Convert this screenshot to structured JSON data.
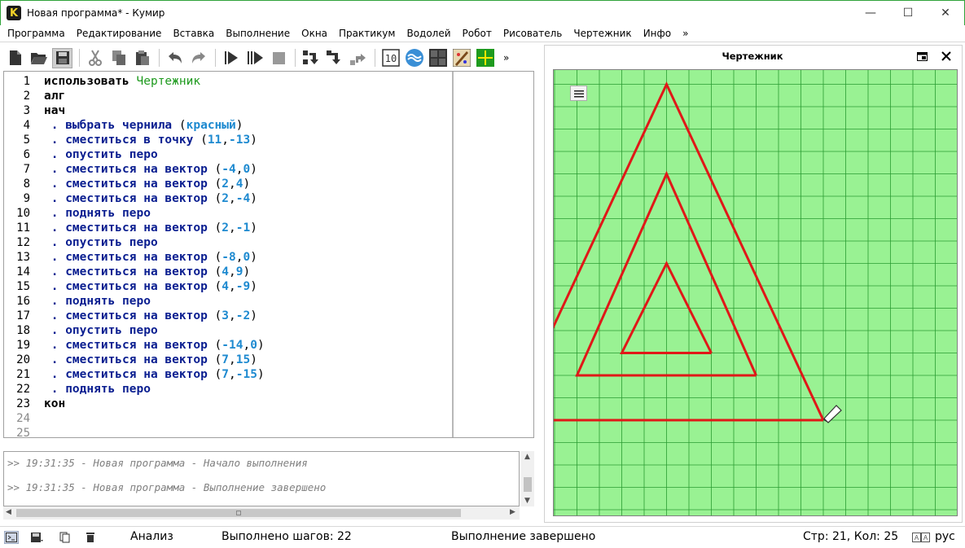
{
  "window": {
    "title": "Новая программа* - Кумир",
    "app_icon_letter": "K",
    "minimize": "—",
    "maximize": "☐",
    "close": "✕"
  },
  "menu": [
    "Программа",
    "Редактирование",
    "Вставка",
    "Выполнение",
    "Окна",
    "Практикум",
    "Водолей",
    "Робот",
    "Рисователь",
    "Чертежник",
    "Инфо",
    "»"
  ],
  "toolbar": {
    "icons": [
      "new-file-icon",
      "open-folder-icon",
      "save-icon",
      "cut-icon",
      "copy-icon",
      "paste-icon",
      "undo-icon",
      "redo-icon",
      "run-icon",
      "run-step-icon",
      "stop-icon",
      "step-over-icon",
      "step-into-icon",
      "step-out-icon",
      "number-icon",
      "vodoley-icon",
      "robot-icon",
      "risovatel-icon",
      "chertezhnik-icon"
    ],
    "more": "»",
    "number_icon_text": "10"
  },
  "editor": {
    "lines": [
      {
        "n": "1",
        "tokens": [
          {
            "t": "использовать ",
            "c": "kw"
          },
          {
            "t": "Чертежник",
            "c": "lib"
          }
        ]
      },
      {
        "n": "2",
        "tokens": [
          {
            "t": "алг",
            "c": "kw"
          }
        ]
      },
      {
        "n": "3",
        "tokens": [
          {
            "t": "нач",
            "c": "kw"
          }
        ]
      },
      {
        "n": "4",
        "tokens": [
          {
            "t": " . ",
            "c": "dot"
          },
          {
            "t": "выбрать чернила ",
            "c": "act"
          },
          {
            "t": "(",
            "c": "plain"
          },
          {
            "t": "красный",
            "c": "str"
          },
          {
            "t": ")",
            "c": "plain"
          }
        ]
      },
      {
        "n": "5",
        "tokens": [
          {
            "t": " . ",
            "c": "dot"
          },
          {
            "t": "сместиться в точку ",
            "c": "act"
          },
          {
            "t": "(",
            "c": "plain"
          },
          {
            "t": "11",
            "c": "num"
          },
          {
            "t": ",",
            "c": "plain"
          },
          {
            "t": "-13",
            "c": "num"
          },
          {
            "t": ")",
            "c": "plain"
          }
        ]
      },
      {
        "n": "6",
        "tokens": [
          {
            "t": " . ",
            "c": "dot"
          },
          {
            "t": "опустить перо",
            "c": "act"
          }
        ]
      },
      {
        "n": "7",
        "tokens": [
          {
            "t": " . ",
            "c": "dot"
          },
          {
            "t": "сместиться на вектор ",
            "c": "act"
          },
          {
            "t": "(",
            "c": "plain"
          },
          {
            "t": "-4",
            "c": "num"
          },
          {
            "t": ",",
            "c": "plain"
          },
          {
            "t": "0",
            "c": "num"
          },
          {
            "t": ")",
            "c": "plain"
          }
        ]
      },
      {
        "n": "8",
        "tokens": [
          {
            "t": " . ",
            "c": "dot"
          },
          {
            "t": "сместиться на вектор ",
            "c": "act"
          },
          {
            "t": "(",
            "c": "plain"
          },
          {
            "t": "2",
            "c": "num"
          },
          {
            "t": ",",
            "c": "plain"
          },
          {
            "t": "4",
            "c": "num"
          },
          {
            "t": ")",
            "c": "plain"
          }
        ]
      },
      {
        "n": "9",
        "tokens": [
          {
            "t": " . ",
            "c": "dot"
          },
          {
            "t": "сместиться на вектор ",
            "c": "act"
          },
          {
            "t": "(",
            "c": "plain"
          },
          {
            "t": "2",
            "c": "num"
          },
          {
            "t": ",",
            "c": "plain"
          },
          {
            "t": "-4",
            "c": "num"
          },
          {
            "t": ")",
            "c": "plain"
          }
        ]
      },
      {
        "n": "10",
        "tokens": [
          {
            "t": " . ",
            "c": "dot"
          },
          {
            "t": "поднять перо",
            "c": "act"
          }
        ]
      },
      {
        "n": "11",
        "tokens": [
          {
            "t": " . ",
            "c": "dot"
          },
          {
            "t": "сместиться на вектор ",
            "c": "act"
          },
          {
            "t": "(",
            "c": "plain"
          },
          {
            "t": "2",
            "c": "num"
          },
          {
            "t": ",",
            "c": "plain"
          },
          {
            "t": "-1",
            "c": "num"
          },
          {
            "t": ")",
            "c": "plain"
          }
        ]
      },
      {
        "n": "12",
        "tokens": [
          {
            "t": " . ",
            "c": "dot"
          },
          {
            "t": "опустить перо",
            "c": "act"
          }
        ]
      },
      {
        "n": "13",
        "tokens": [
          {
            "t": " . ",
            "c": "dot"
          },
          {
            "t": "сместиться на вектор ",
            "c": "act"
          },
          {
            "t": "(",
            "c": "plain"
          },
          {
            "t": "-8",
            "c": "num"
          },
          {
            "t": ",",
            "c": "plain"
          },
          {
            "t": "0",
            "c": "num"
          },
          {
            "t": ")",
            "c": "plain"
          }
        ]
      },
      {
        "n": "14",
        "tokens": [
          {
            "t": " . ",
            "c": "dot"
          },
          {
            "t": "сместиться на вектор ",
            "c": "act"
          },
          {
            "t": "(",
            "c": "plain"
          },
          {
            "t": "4",
            "c": "num"
          },
          {
            "t": ",",
            "c": "plain"
          },
          {
            "t": "9",
            "c": "num"
          },
          {
            "t": ")",
            "c": "plain"
          }
        ]
      },
      {
        "n": "15",
        "tokens": [
          {
            "t": " . ",
            "c": "dot"
          },
          {
            "t": "сместиться на вектор ",
            "c": "act"
          },
          {
            "t": "(",
            "c": "plain"
          },
          {
            "t": "4",
            "c": "num"
          },
          {
            "t": ",",
            "c": "plain"
          },
          {
            "t": "-9",
            "c": "num"
          },
          {
            "t": ")",
            "c": "plain"
          }
        ]
      },
      {
        "n": "16",
        "tokens": [
          {
            "t": " . ",
            "c": "dot"
          },
          {
            "t": "поднять перо",
            "c": "act"
          }
        ]
      },
      {
        "n": "17",
        "tokens": [
          {
            "t": " . ",
            "c": "dot"
          },
          {
            "t": "сместиться на вектор ",
            "c": "act"
          },
          {
            "t": "(",
            "c": "plain"
          },
          {
            "t": "3",
            "c": "num"
          },
          {
            "t": ",",
            "c": "plain"
          },
          {
            "t": "-2",
            "c": "num"
          },
          {
            "t": ")",
            "c": "plain"
          }
        ]
      },
      {
        "n": "18",
        "tokens": [
          {
            "t": " . ",
            "c": "dot"
          },
          {
            "t": "опустить перо",
            "c": "act"
          }
        ]
      },
      {
        "n": "19",
        "tokens": [
          {
            "t": " . ",
            "c": "dot"
          },
          {
            "t": "сместиться на вектор ",
            "c": "act"
          },
          {
            "t": "(",
            "c": "plain"
          },
          {
            "t": "-14",
            "c": "num"
          },
          {
            "t": ",",
            "c": "plain"
          },
          {
            "t": "0",
            "c": "num"
          },
          {
            "t": ")",
            "c": "plain"
          }
        ]
      },
      {
        "n": "20",
        "tokens": [
          {
            "t": " . ",
            "c": "dot"
          },
          {
            "t": "сместиться на вектор ",
            "c": "act"
          },
          {
            "t": "(",
            "c": "plain"
          },
          {
            "t": "7",
            "c": "num"
          },
          {
            "t": ",",
            "c": "plain"
          },
          {
            "t": "15",
            "c": "num"
          },
          {
            "t": ")",
            "c": "plain"
          }
        ]
      },
      {
        "n": "21",
        "tokens": [
          {
            "t": " . ",
            "c": "dot"
          },
          {
            "t": "сместиться на вектор ",
            "c": "act"
          },
          {
            "t": "(",
            "c": "plain"
          },
          {
            "t": "7",
            "c": "num"
          },
          {
            "t": ",",
            "c": "plain"
          },
          {
            "t": "-15",
            "c": "num"
          },
          {
            "t": ")",
            "c": "plain"
          }
        ]
      },
      {
        "n": "22",
        "tokens": [
          {
            "t": " . ",
            "c": "dot"
          },
          {
            "t": "поднять перо",
            "c": "act"
          }
        ]
      },
      {
        "n": "23",
        "tokens": [
          {
            "t": "кон",
            "c": "kw"
          }
        ]
      },
      {
        "n": "24",
        "tokens": []
      },
      {
        "n": "25",
        "tokens": []
      }
    ]
  },
  "console": {
    "lines": [
      ">> 19:31:35 - Новая программа - Начало выполнения",
      ">> 19:31:35 - Новая программа - Выполнение завершено"
    ]
  },
  "drawer": {
    "title": "Чертежник",
    "colors": {
      "background": "#99f293",
      "grid": "#2b9c33",
      "ink": "#e01818"
    },
    "pen_start": [
      11,
      -13
    ],
    "pen_down_segments": [
      [
        [
          11,
          -13
        ],
        [
          7,
          -13
        ],
        [
          9,
          -9
        ],
        [
          11,
          -13
        ]
      ],
      [
        [
          13,
          -14
        ],
        [
          5,
          -14
        ],
        [
          9,
          -5
        ],
        [
          13,
          -14
        ]
      ],
      [
        [
          16,
          -16
        ],
        [
          2,
          -16
        ],
        [
          9,
          -1
        ],
        [
          16,
          -16
        ]
      ]
    ],
    "pen_end": [
      16,
      -16
    ]
  },
  "status": {
    "analysis": "Анализ",
    "steps": "Выполнено шагов: 22",
    "state": "Выполнение завершено",
    "cursor": "Стр: 21, Кол: 25",
    "lang": "рус"
  }
}
